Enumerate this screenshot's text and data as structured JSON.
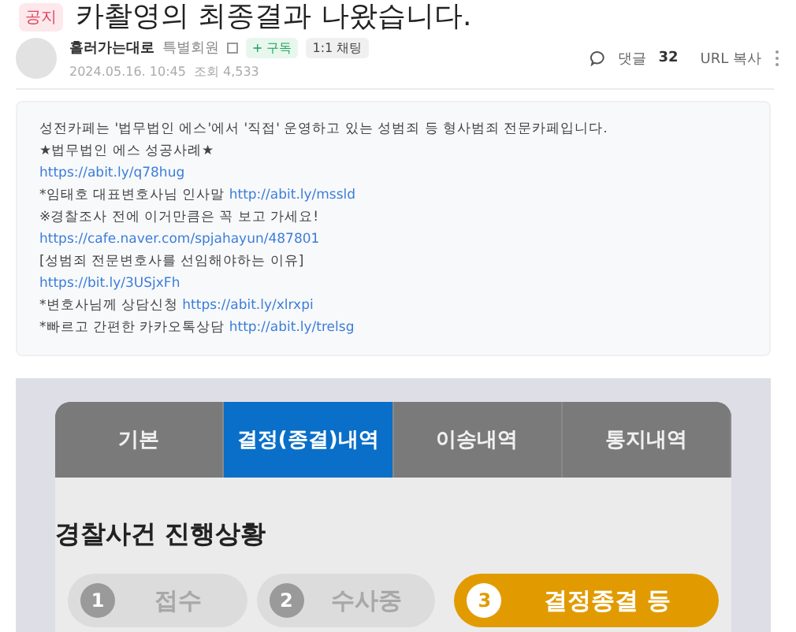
{
  "post": {
    "badge": "공지",
    "title": "카촬영의 최종결과 나왔습니다."
  },
  "author": {
    "name": "흘러가는대로",
    "grade": "특별회원",
    "subscribe": "+ 구독",
    "chat": "1:1 채팅",
    "date": "2024.05.16. 10:45",
    "views": "조회 4,533"
  },
  "actions": {
    "comments_label": "댓글",
    "comments_count": "32",
    "url_copy": "URL 복사"
  },
  "notice_lines": [
    {
      "text": "성전카페는 '법무법인 에스'에서 '직접' 운영하고 있는 성범죄 등 형사범죄 전문카페입니다."
    },
    {
      "text": "★법무법인 에스 성공사례★"
    },
    {
      "link": "https://abit.ly/q78hug"
    },
    {
      "text": "*임태호 대표변호사님 인사말",
      "link": "http://abit.ly/mssld"
    },
    {
      "text": "※경찰조사 전에 이거만큼은 꼭 보고 가세요!"
    },
    {
      "link": "https://cafe.naver.com/spjahayun/487801"
    },
    {
      "text": "[성범죄 전문변호사를 선임해야하는 이유]"
    },
    {
      "link": "https://bit.ly/3USjxFh"
    },
    {
      "text": "*변호사님께 상담신청",
      "link": "https://abit.ly/xlrxpi"
    },
    {
      "text": "*빠르고 간편한 카카오톡상담",
      "link": "http://abit.ly/trelsg"
    }
  ],
  "screenshot": {
    "tabs": [
      {
        "label": "기본",
        "selected": false
      },
      {
        "label": "결정(종결)내역",
        "selected": true
      },
      {
        "label": "이송내역",
        "selected": false
      },
      {
        "label": "통지내역",
        "selected": false
      }
    ],
    "heading": "경찰사건 진행상황",
    "steps": [
      {
        "number": "1",
        "label": "접수",
        "selected": false
      },
      {
        "number": "2",
        "label": "수사중",
        "selected": false
      },
      {
        "number": "3",
        "label": "결정종결 등",
        "selected": true
      }
    ]
  }
}
